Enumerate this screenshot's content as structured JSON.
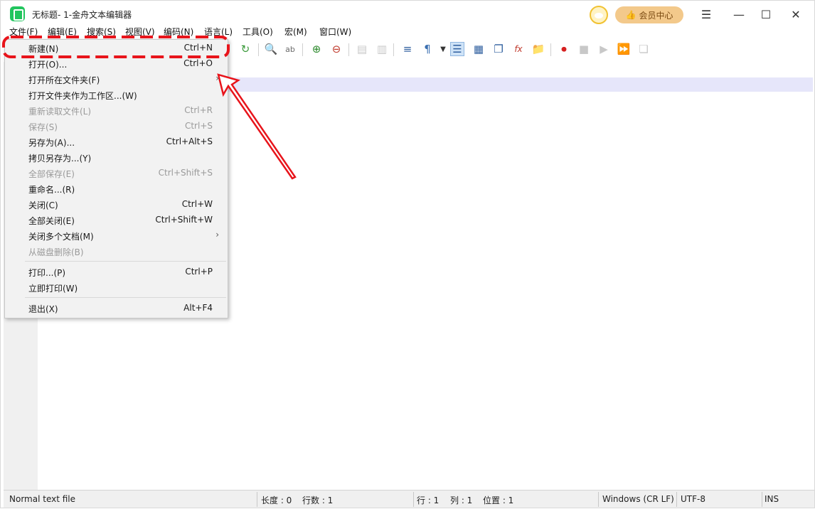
{
  "window": {
    "title": "无标题- 1-金舟文本编辑器",
    "vip_label": "会员中心"
  },
  "menubar": [
    {
      "label": "文件(F)"
    },
    {
      "label": "编辑(E)"
    },
    {
      "label": "搜索(S)"
    },
    {
      "label": "视图(V)"
    },
    {
      "label": "编码(N)"
    },
    {
      "label": "语言(L)"
    },
    {
      "label": "工具(O)"
    },
    {
      "label": "宏(M)"
    },
    {
      "label": "窗口(W)"
    }
  ],
  "file_menu": {
    "items": [
      {
        "label": "新建(N)",
        "shortcut": "Ctrl+N",
        "enabled": true,
        "highlighted": true
      },
      {
        "label": "打开(O)...",
        "shortcut": "Ctrl+O",
        "enabled": true
      },
      {
        "label": "打开所在文件夹(F)",
        "shortcut": "",
        "enabled": true,
        "submenu": true
      },
      {
        "label": "打开文件夹作为工作区...(W)",
        "shortcut": "",
        "enabled": true
      },
      {
        "label": "重新读取文件(L)",
        "shortcut": "Ctrl+R",
        "enabled": false
      },
      {
        "label": "保存(S)",
        "shortcut": "Ctrl+S",
        "enabled": false
      },
      {
        "label": "另存为(A)...",
        "shortcut": "Ctrl+Alt+S",
        "enabled": true
      },
      {
        "label": "拷贝另存为...(Y)",
        "shortcut": "",
        "enabled": true
      },
      {
        "label": "全部保存(E)",
        "shortcut": "Ctrl+Shift+S",
        "enabled": false
      },
      {
        "label": "重命名...(R)",
        "shortcut": "",
        "enabled": true
      },
      {
        "label": "关闭(C)",
        "shortcut": "Ctrl+W",
        "enabled": true
      },
      {
        "label": "全部关闭(E)",
        "shortcut": "Ctrl+Shift+W",
        "enabled": true
      },
      {
        "label": "关闭多个文档(M)",
        "shortcut": "",
        "enabled": true,
        "submenu": true
      },
      {
        "label": "从磁盘删除(B)",
        "shortcut": "",
        "enabled": false
      },
      {
        "label": "打印...(P)",
        "shortcut": "Ctrl+P",
        "enabled": true
      },
      {
        "label": "立即打印(W)",
        "shortcut": "",
        "enabled": true
      },
      {
        "label": "退出(X)",
        "shortcut": "Alt+F4",
        "enabled": true
      }
    ],
    "submenu_glyph": "›"
  },
  "statusbar": {
    "file_type": "Normal text file",
    "length": "长度 : 0",
    "lines": "行数 : 1",
    "row": "行 : 1",
    "col": "列 : 1",
    "position": "位置 : 1",
    "eol": "Windows (CR LF)",
    "encoding": "UTF-8",
    "mode": "INS"
  },
  "colors": {
    "annotation_red": "#e8141b",
    "app_icon": "#22c55e",
    "vip_button": "#f3c98b",
    "current_line": "#e6e6fa"
  }
}
